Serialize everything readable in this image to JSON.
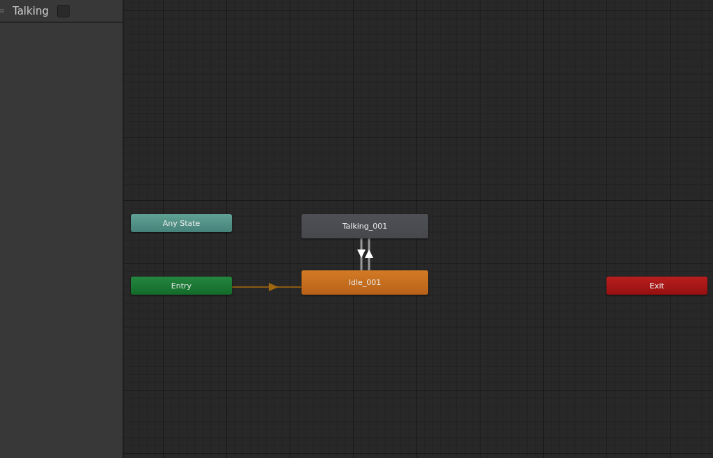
{
  "layer": {
    "name": "Talking",
    "checked": false
  },
  "nodes": [
    {
      "label": "Any State",
      "kind": "any"
    },
    {
      "label": "Entry",
      "kind": "entry"
    },
    {
      "label": "Talking_001",
      "kind": "state"
    },
    {
      "label": "Idle_001",
      "kind": "default"
    },
    {
      "label": "Exit",
      "kind": "exit"
    }
  ]
}
